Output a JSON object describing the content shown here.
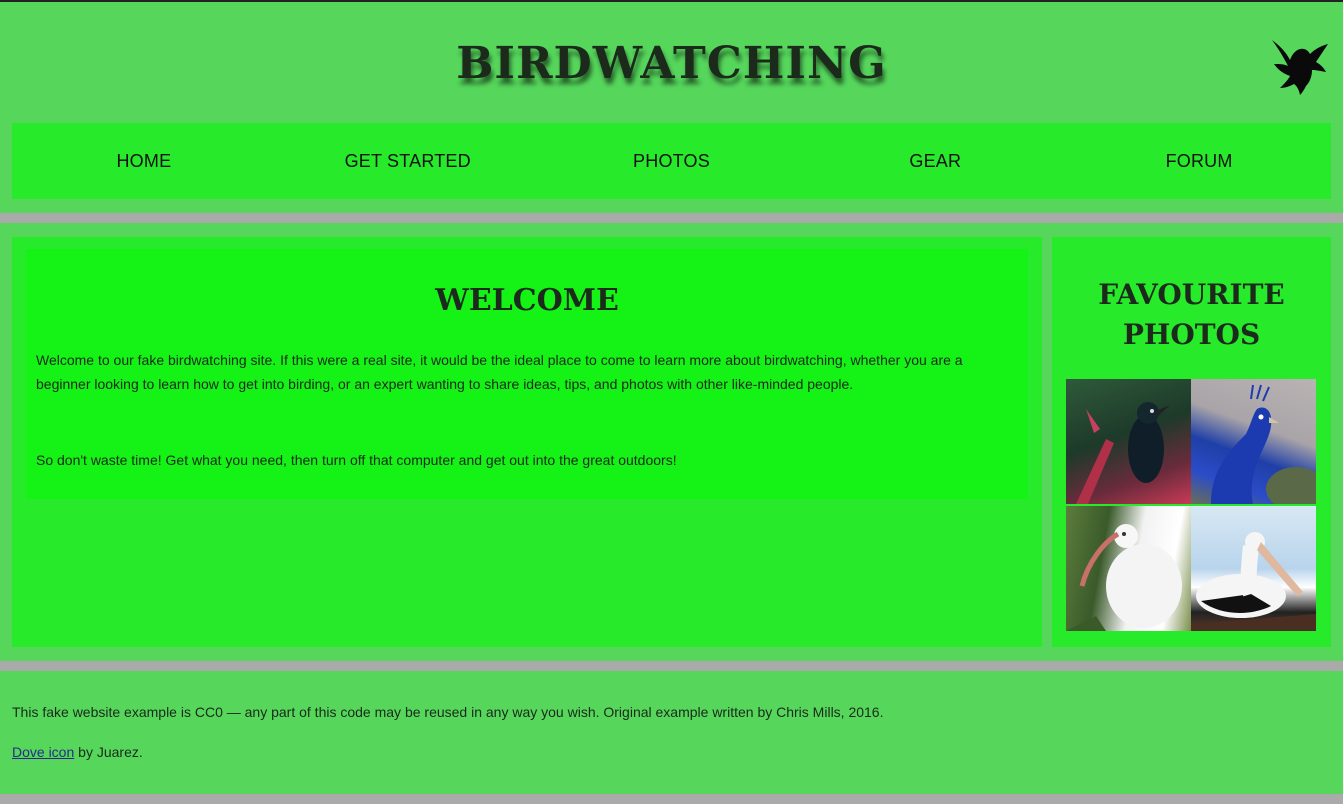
{
  "header": {
    "title": "BIRDWATCHING",
    "logo_icon": "dove-icon"
  },
  "nav": {
    "items": [
      {
        "label": "HOME"
      },
      {
        "label": "GET STARTED"
      },
      {
        "label": "PHOTOS"
      },
      {
        "label": "GEAR"
      },
      {
        "label": "FORUM"
      }
    ]
  },
  "article": {
    "heading": "WELCOME",
    "paragraphs": [
      "Welcome to our fake birdwatching site. If this were a real site, it would be the ideal place to come to learn more about birdwatching, whether you are a beginner looking to learn how to get into birding, or an expert wanting to share ideas, tips, and photos with other like-minded people.",
      "So don't waste time! Get what you need, then turn off that computer and get out into the great outdoors!"
    ]
  },
  "sidebar": {
    "heading": "FAVOURITE PHOTOS",
    "photos": [
      {
        "subject": "tui-bird-photo"
      },
      {
        "subject": "peacock-photo"
      },
      {
        "subject": "white-ibis-photo"
      },
      {
        "subject": "pelican-photo"
      }
    ]
  },
  "footer": {
    "credit": "This fake website example is CC0 — any part of this code may be reused in any way you wish. Original example written by Chris Mills, 2016.",
    "icon_link": "Dove icon",
    "icon_credit": " by Juarez."
  },
  "colors": {
    "page_bg": "#aaaaaa",
    "section_bg": "#56d75c",
    "nav_bg": "#27ea2a",
    "article_bg": "#14f216"
  }
}
